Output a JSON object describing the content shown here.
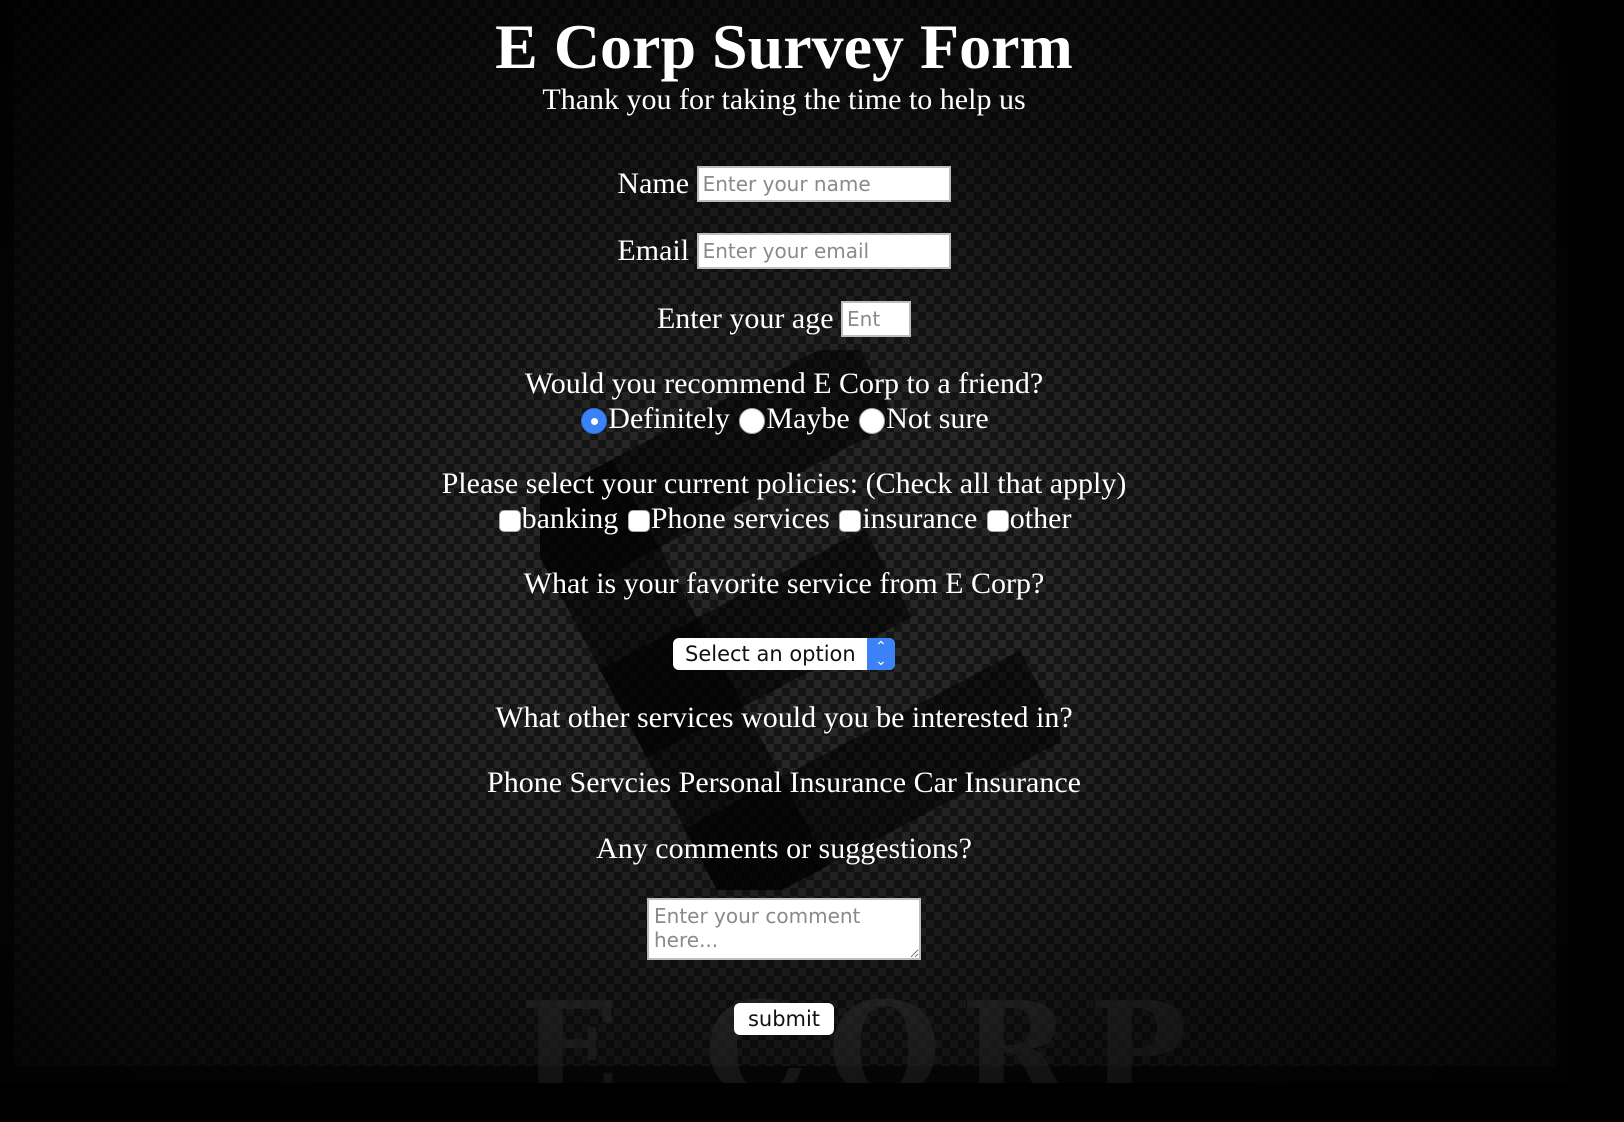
{
  "header": {
    "title": "E Corp Survey Form",
    "subtitle": "Thank you for taking the time to help us"
  },
  "form": {
    "name": {
      "label": "Name",
      "placeholder": "Enter your name",
      "value": ""
    },
    "email": {
      "label": "Email",
      "placeholder": "Enter your email",
      "value": ""
    },
    "age": {
      "label": "Enter your age",
      "placeholder": "Ent",
      "value": ""
    },
    "recommend": {
      "question": "Would you recommend E Corp to a friend?",
      "options": [
        {
          "label": "Definitely",
          "selected": true
        },
        {
          "label": "Maybe",
          "selected": false
        },
        {
          "label": "Not sure",
          "selected": false
        }
      ]
    },
    "policies": {
      "question": "Please select your current policies: (Check all that apply)",
      "options": [
        {
          "label": "banking",
          "checked": false
        },
        {
          "label": "Phone services",
          "checked": false
        },
        {
          "label": "insurance",
          "checked": false
        },
        {
          "label": "other",
          "checked": false
        }
      ]
    },
    "favorite": {
      "question": "What is your favorite service from E Corp?",
      "selected": "Select an option"
    },
    "other_services": {
      "question": "What other services would you be interested in?",
      "text": "Phone Servcies Personal Insurance Car Insurance"
    },
    "comments": {
      "question": "Any comments or suggestions?",
      "placeholder": "Enter your comment here..."
    },
    "submit_label": "submit"
  },
  "colors": {
    "accent": "#3b82f6",
    "background": "#141414",
    "text": "#ffffff"
  }
}
